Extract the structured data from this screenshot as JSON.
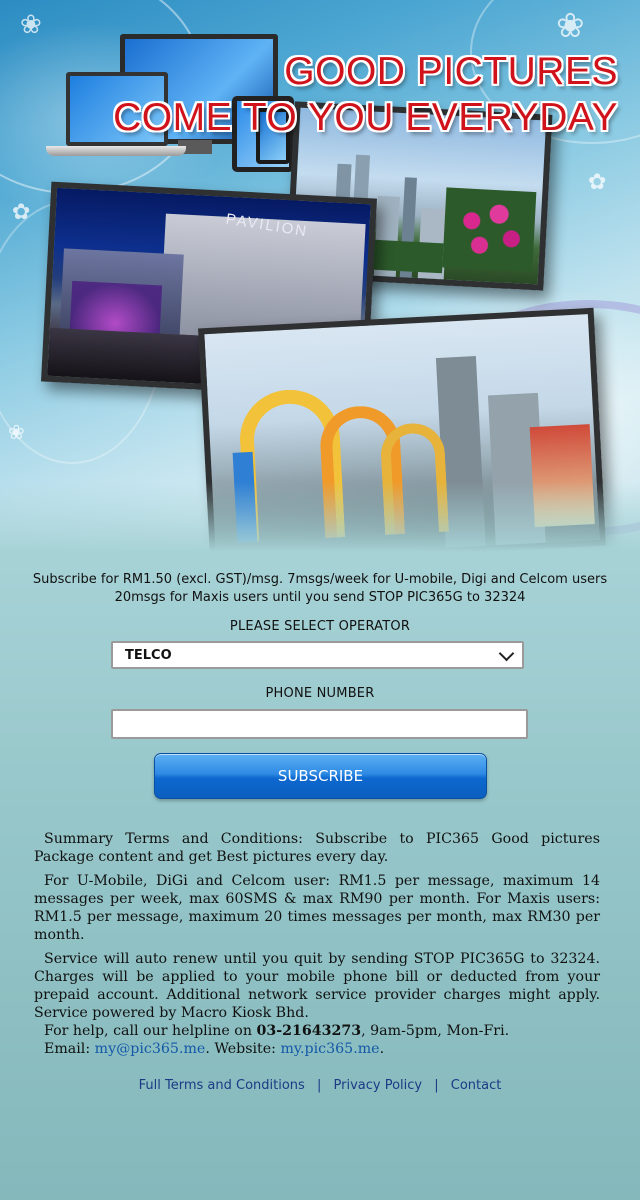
{
  "banner": {
    "headline_line1": "GOOD PICTURES",
    "headline_line2": "COME TO YOU EVERYDAY",
    "mall_sign": "PAVILION"
  },
  "intro": {
    "line1": "Subscribe for RM1.50 (excl. GST)/msg. 7msgs/week for U-mobile, Digi and Celcom users",
    "line2": "20msgs for Maxis users until you send STOP PIC365G to 32324"
  },
  "form": {
    "operator_label": "PLEASE SELECT OPERATOR",
    "operator_value": "TELCO",
    "phone_label": "PHONE NUMBER",
    "phone_value": "",
    "phone_placeholder": "",
    "subscribe_label": "SUBSCRIBE"
  },
  "terms": {
    "summary": "Summary Terms and Conditions: Subscribe to PIC365 Good pictures Package content and get Best pictures every day.",
    "pricing": "For U-Mobile, DiGi and Celcom user: RM1.5 per message, maximum 14 messages per week, max 60SMS & max RM90 per month. For Maxis users: RM1.5 per message, maximum 20 times messages per month, max RM30 per month.",
    "renewal": "Service will auto renew until you quit by sending STOP PIC365G to 32324. Charges will be applied to your mobile phone bill or deducted from your prepaid account. Additional network service provider charges might apply. Service powered by Macro Kiosk Bhd.",
    "help_prefix": "For help, call our helpline on ",
    "helpline": "03-21643273",
    "help_suffix": ", 9am-5pm, Mon-Fri.",
    "email_prefix": "Email: ",
    "email": "my@pic365.me",
    "website_prefix": ". Website: ",
    "website": "my.pic365.me",
    "website_suffix": "."
  },
  "footer": {
    "links": [
      "Full Terms and Conditions",
      "Privacy Policy",
      "Contact"
    ],
    "separator": "|"
  },
  "colors": {
    "headline": "#d0131b",
    "button": "#0d68cf",
    "link": "#1558a8",
    "footer_link": "#1c3a86"
  }
}
